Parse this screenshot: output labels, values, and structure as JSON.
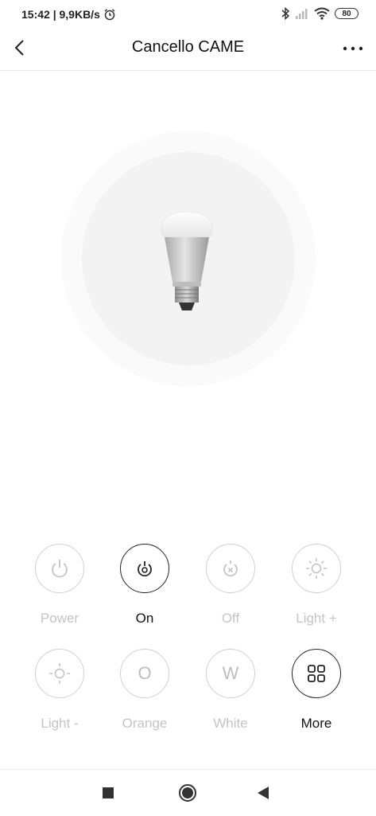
{
  "status_bar": {
    "time_speed": "15:42 | 9,9KB/s",
    "battery": "80"
  },
  "header": {
    "title": "Cancello CAME"
  },
  "controls": [
    {
      "label": "Power",
      "active": false,
      "icon": "power-icon"
    },
    {
      "label": "On",
      "active": true,
      "icon": "on-icon"
    },
    {
      "label": "Off",
      "active": false,
      "icon": "off-icon"
    },
    {
      "label": "Light +",
      "active": false,
      "icon": "sun-bright-icon"
    },
    {
      "label": "Light -",
      "active": false,
      "icon": "sun-dim-icon"
    },
    {
      "label": "Orange",
      "active": false,
      "glyph": "O"
    },
    {
      "label": "White",
      "active": false,
      "glyph": "W"
    },
    {
      "label": "More",
      "active": true,
      "icon": "grid-icon"
    }
  ],
  "colors": {
    "active": "#222222",
    "inactive": "#c4c4c4"
  }
}
